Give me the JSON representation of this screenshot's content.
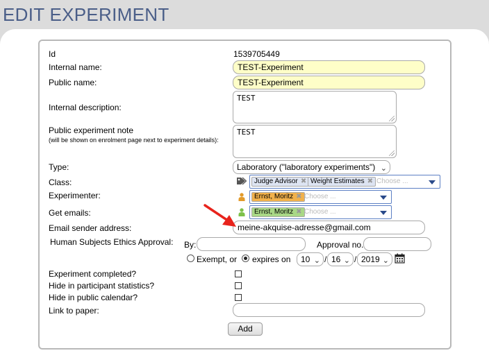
{
  "page_title": "EDIT EXPERIMENT",
  "colors": {
    "title": "#4a5e88",
    "required_bg": "#fefec8",
    "chosen_border": "#5b7fc4",
    "arrow": "#e8231c"
  },
  "fields": {
    "id": {
      "label": "Id",
      "value": "1539705449"
    },
    "internal_name": {
      "label": "Internal name:",
      "value": "TEST-Experiment"
    },
    "public_name": {
      "label": "Public name:",
      "value": "TEST-Experiment"
    },
    "internal_description": {
      "label": "Internal description:",
      "value": "TEST"
    },
    "public_note": {
      "label": "Public experiment note",
      "sublabel": "(will be shown on enrolment page next to experiment details):",
      "value": "TEST"
    },
    "type": {
      "label": "Type:",
      "value": "Laboratory (\"laboratory experiments\")"
    },
    "class": {
      "label": "Class:",
      "icon": "tag-icon",
      "tags": [
        "Judge Advisor",
        "Weight Estimates"
      ],
      "placeholder": "Choose ..."
    },
    "experimenter": {
      "label": "Experimenter:",
      "icon": "person-icon",
      "tags": [
        "Ernst, Moritz"
      ],
      "placeholder": "Choose ..."
    },
    "get_emails": {
      "label": "Get emails:",
      "icon": "person-icon",
      "tags": [
        "Ernst, Moritz"
      ],
      "placeholder": "Choose ..."
    },
    "email_sender": {
      "label": "Email sender address:",
      "value": "meine-akquise-adresse@gmail.com"
    },
    "ethics": {
      "label": "Human Subjects Ethics Approval:",
      "by_label": "By:",
      "by_value": "",
      "approval_label": "Approval no.",
      "approval_value": "",
      "exempt_label": "Exempt, or",
      "expires_label": "expires on",
      "selected": "expires",
      "month": "10",
      "day": "16",
      "year": "2019",
      "separator": "/"
    },
    "completed": {
      "label": "Experiment completed?",
      "checked": false
    },
    "hide_stats": {
      "label": "Hide in participant statistics?",
      "checked": false
    },
    "hide_calendar": {
      "label": "Hide in public calendar?",
      "checked": false
    },
    "link_paper": {
      "label": "Link to paper:",
      "value": ""
    }
  },
  "add_button": "Add"
}
